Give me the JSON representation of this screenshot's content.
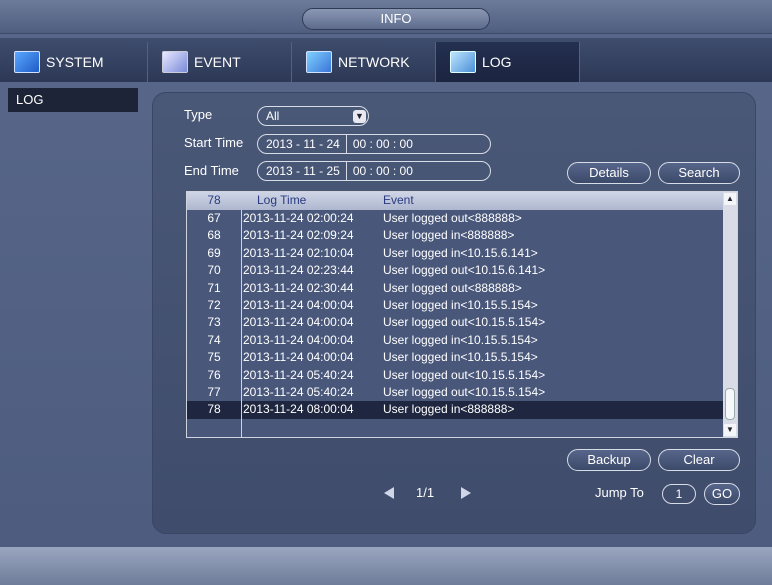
{
  "window": {
    "title": "INFO"
  },
  "tabs": [
    {
      "label": "SYSTEM",
      "icon": "system-icon"
    },
    {
      "label": "EVENT",
      "icon": "event-icon"
    },
    {
      "label": "NETWORK",
      "icon": "network-icon"
    },
    {
      "label": "LOG",
      "icon": "log-icon",
      "active": true
    }
  ],
  "sidebar": {
    "items": [
      {
        "label": "LOG",
        "selected": true
      }
    ]
  },
  "filters": {
    "type_label": "Type",
    "type_value": "All",
    "start_label": "Start Time",
    "start_date": "2013 - 11 - 24",
    "start_time": "00 : 00 : 00",
    "end_label": "End Time",
    "end_date": "2013 - 11 - 25",
    "end_time": "00 : 00 : 00"
  },
  "buttons": {
    "details": "Details",
    "search": "Search",
    "backup": "Backup",
    "clear": "Clear",
    "go": "GO"
  },
  "table": {
    "count": "78",
    "headers": {
      "time": "Log Time",
      "event": "Event"
    },
    "rows": [
      {
        "no": "67",
        "time": "2013-11-24 02:00:24",
        "event": "User logged out<888888>"
      },
      {
        "no": "68",
        "time": "2013-11-24 02:09:24",
        "event": "User logged in<888888>"
      },
      {
        "no": "69",
        "time": "2013-11-24 02:10:04",
        "event": "User logged in<10.15.6.141>"
      },
      {
        "no": "70",
        "time": "2013-11-24 02:23:44",
        "event": "User logged out<10.15.6.141>"
      },
      {
        "no": "71",
        "time": "2013-11-24 02:30:44",
        "event": "User logged out<888888>"
      },
      {
        "no": "72",
        "time": "2013-11-24 04:00:04",
        "event": "User logged in<10.15.5.154>"
      },
      {
        "no": "73",
        "time": "2013-11-24 04:00:04",
        "event": "User logged out<10.15.5.154>"
      },
      {
        "no": "74",
        "time": "2013-11-24 04:00:04",
        "event": "User logged in<10.15.5.154>"
      },
      {
        "no": "75",
        "time": "2013-11-24 04:00:04",
        "event": "User logged in<10.15.5.154>"
      },
      {
        "no": "76",
        "time": "2013-11-24 05:40:24",
        "event": "User logged out<10.15.5.154>"
      },
      {
        "no": "77",
        "time": "2013-11-24 05:40:24",
        "event": "User logged out<10.15.5.154>"
      },
      {
        "no": "78",
        "time": "2013-11-24 08:00:04",
        "event": "User logged in<888888>",
        "selected": true
      }
    ]
  },
  "pagination": {
    "page": "1/1",
    "jump_label": "Jump To",
    "jump_value": "1"
  },
  "colors": {
    "selected_row": "#1f2740",
    "panel_bg": "#44526f",
    "header_text": "#2a3a80"
  }
}
